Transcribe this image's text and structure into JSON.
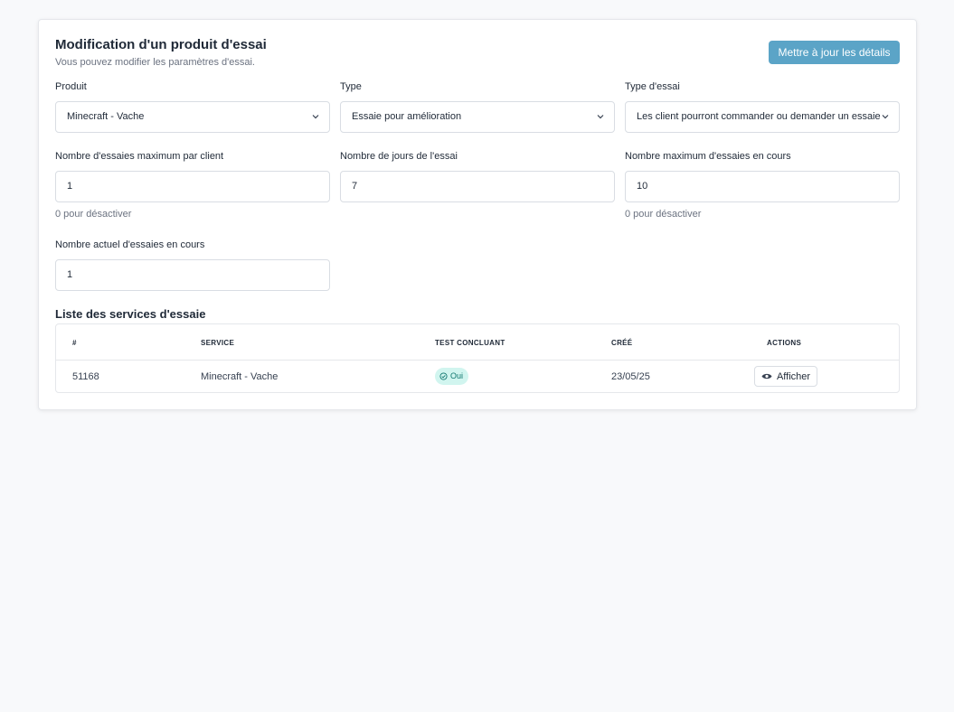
{
  "header": {
    "title": "Modification d'un produit d'essai",
    "subtitle": "Vous pouvez modifier les paramètres d'essai.",
    "update_label": "Mettre à jour les détails"
  },
  "form": {
    "produit": {
      "label": "Produit",
      "value": "Minecraft - Vache"
    },
    "type": {
      "label": "Type",
      "value": "Essaie pour amélioration"
    },
    "type_essai": {
      "label": "Type d'essai",
      "value": "Les client pourront commander ou demander un essaie"
    },
    "max_per_client": {
      "label": "Nombre d'essaies maximum par client",
      "value": "1",
      "hint": "0 pour désactiver"
    },
    "days": {
      "label": "Nombre de jours de l'essai",
      "value": "7"
    },
    "max_active": {
      "label": "Nombre maximum d'essaies en cours",
      "value": "10",
      "hint": "0 pour désactiver"
    },
    "current_active": {
      "label": "Nombre actuel d'essaies en cours",
      "value": "1"
    }
  },
  "services": {
    "title": "Liste des services d'essaie",
    "columns": [
      "#",
      "SERVICE",
      "TEST CONCLUANT",
      "CRÉÉ",
      "ACTIONS"
    ],
    "rows": [
      {
        "id": "51168",
        "service": "Minecraft - Vache",
        "conclusive": "Oui",
        "created": "23/05/25",
        "action": "Afficher"
      }
    ]
  },
  "colors": {
    "accent": "#5ba4c7",
    "badge_bg": "#d1f5ef",
    "badge_text": "#0f766e"
  },
  "icons": [
    "chevron-down-icon",
    "check-circle-icon",
    "eye-icon"
  ]
}
